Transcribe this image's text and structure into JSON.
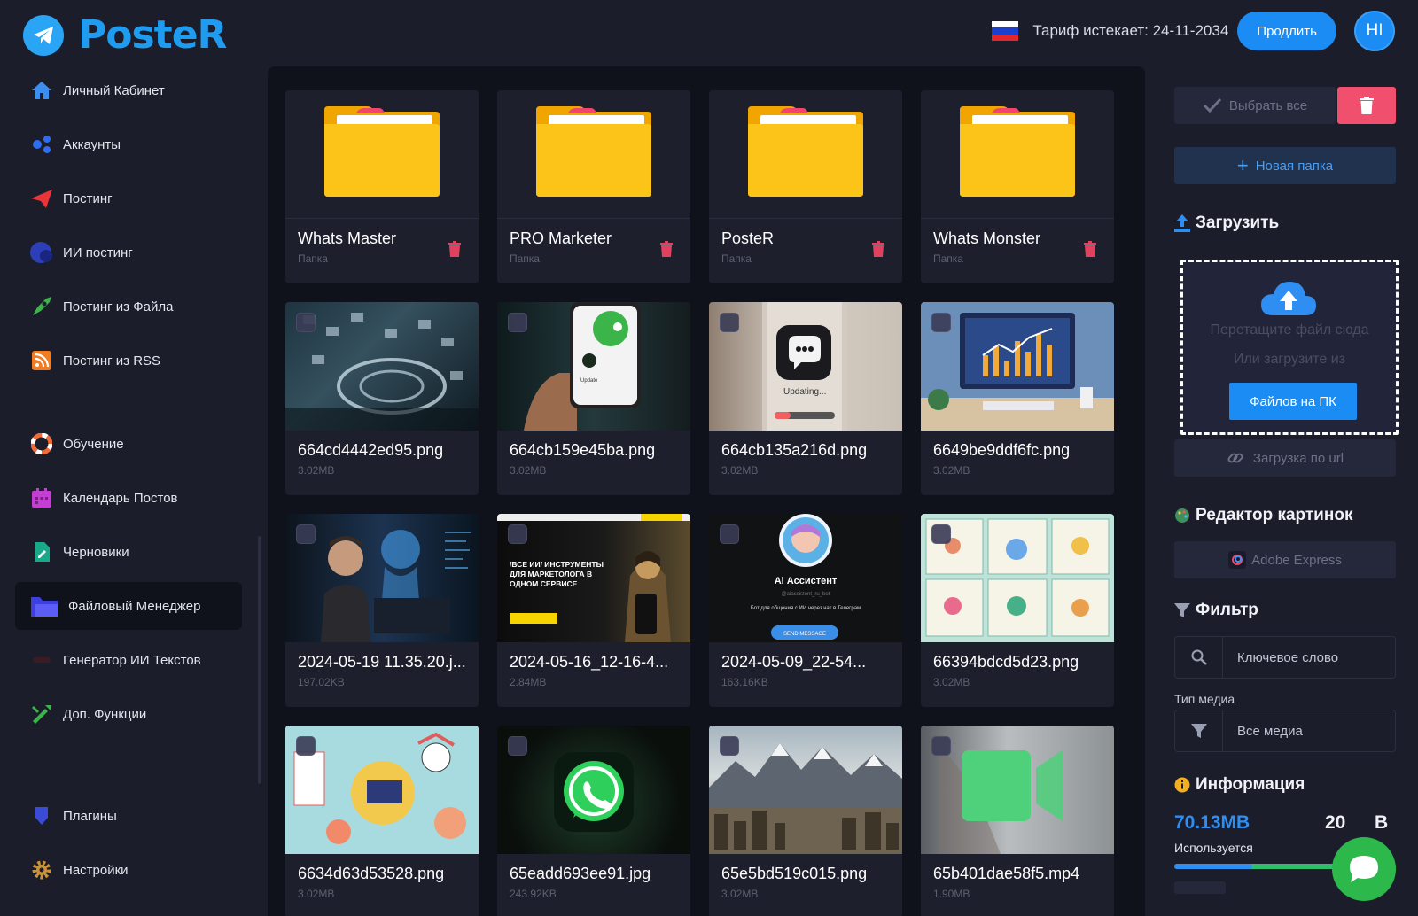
{
  "app": {
    "name": "PosteR"
  },
  "header": {
    "tariff_text": "Тариф истекает: 24-11-2034",
    "prolong_label": "Продлить",
    "avatar_initials": "HI"
  },
  "sidebar": {
    "items": [
      {
        "label": "Личный Кабинет",
        "icon": "home-icon"
      },
      {
        "label": "Аккаунты",
        "icon": "accounts-icon"
      },
      {
        "label": "Постинг",
        "icon": "send-icon"
      },
      {
        "label": "ИИ постинг",
        "icon": "ai-icon"
      },
      {
        "label": "Постинг из Файла",
        "icon": "rocket-icon"
      },
      {
        "label": "Постинг из RSS",
        "icon": "rss-icon"
      },
      {
        "label": "Обучение",
        "icon": "lifebuoy-icon"
      },
      {
        "label": "Календарь Постов",
        "icon": "calendar-icon"
      },
      {
        "label": "Черновики",
        "icon": "draft-icon"
      },
      {
        "label": "Файловый Менеджер",
        "icon": "folder-icon"
      },
      {
        "label": "Генератор ИИ Текстов",
        "icon": "ai-text-icon"
      },
      {
        "label": "Доп. Функции",
        "icon": "tools-icon"
      },
      {
        "label": "Плагины",
        "icon": "plugin-icon"
      },
      {
        "label": "Настройки",
        "icon": "gear-icon"
      }
    ]
  },
  "folders": [
    {
      "name": "Whats Master",
      "sub": "Папка"
    },
    {
      "name": "PRO Marketer",
      "sub": "Папка"
    },
    {
      "name": "PosteR",
      "sub": "Папка"
    },
    {
      "name": "Whats Monster",
      "sub": "Папка"
    }
  ],
  "files": [
    {
      "name": "664cd4442ed95.png",
      "size": "3.02MB"
    },
    {
      "name": "664cb159e45ba.png",
      "size": "3.02MB"
    },
    {
      "name": "664cb135a216d.png",
      "size": "3.02MB"
    },
    {
      "name": "6649be9ddf6fc.png",
      "size": "3.02MB"
    },
    {
      "name": "2024-05-19 11.35.20.j...",
      "size": "197.02KB"
    },
    {
      "name": "2024-05-16_12-16-4...",
      "size": "2.84MB"
    },
    {
      "name": "2024-05-09_22-54...",
      "size": "163.16KB"
    },
    {
      "name": "66394bdcd5d23.png",
      "size": "3.02MB"
    },
    {
      "name": "6634d63d53528.png",
      "size": "3.02MB"
    },
    {
      "name": "65eadd693ee91.jpg",
      "size": "243.92KB"
    },
    {
      "name": "65e5bd519c015.png",
      "size": "3.02MB"
    },
    {
      "name": "65b401dae58f5.mp4",
      "size": "1.90MB"
    }
  ],
  "thumb_text": {
    "updating": "Updating...",
    "ai_title": "Ai Ассистент",
    "ai_handle": "@aiassistent_ru_bot",
    "ai_desc": "Бот для общения с ИИ через чат в Телеграм",
    "ai_btn": "SEND MESSAGE",
    "promo_title": "/ВСЕ ИИ/ ИНСТРУМЕНТЫ ДЛЯ МАРКЕТОЛОГА В ОДНОМ СЕРВИСЕ"
  },
  "right": {
    "select_all": "Выбрать все",
    "new_folder": "Новая папка",
    "upload_title": "Загрузить",
    "drop_line1": "Перетащите файл сюда",
    "drop_line2": "Или загрузите из",
    "from_pc": "Файлов на ПК",
    "url_upload": "Загрузка по url",
    "editor_title": "Редактор картинок",
    "adobe": "Adobe Express",
    "filter_title": "Фильтр",
    "keyword_placeholder": "Ключевое слово",
    "media_type_label": "Тип медиа",
    "media_type_value": "Все медиа",
    "info_title": "Информация",
    "used_value": "70.13MB",
    "total_value": "20",
    "total_suffix": "B",
    "used_label": "Используется",
    "usage_fraction": 0.35
  },
  "colors": {
    "accent": "#1a8cf3",
    "danger": "#f0506e",
    "folder": "#fcc419",
    "chat": "#2db84b"
  }
}
